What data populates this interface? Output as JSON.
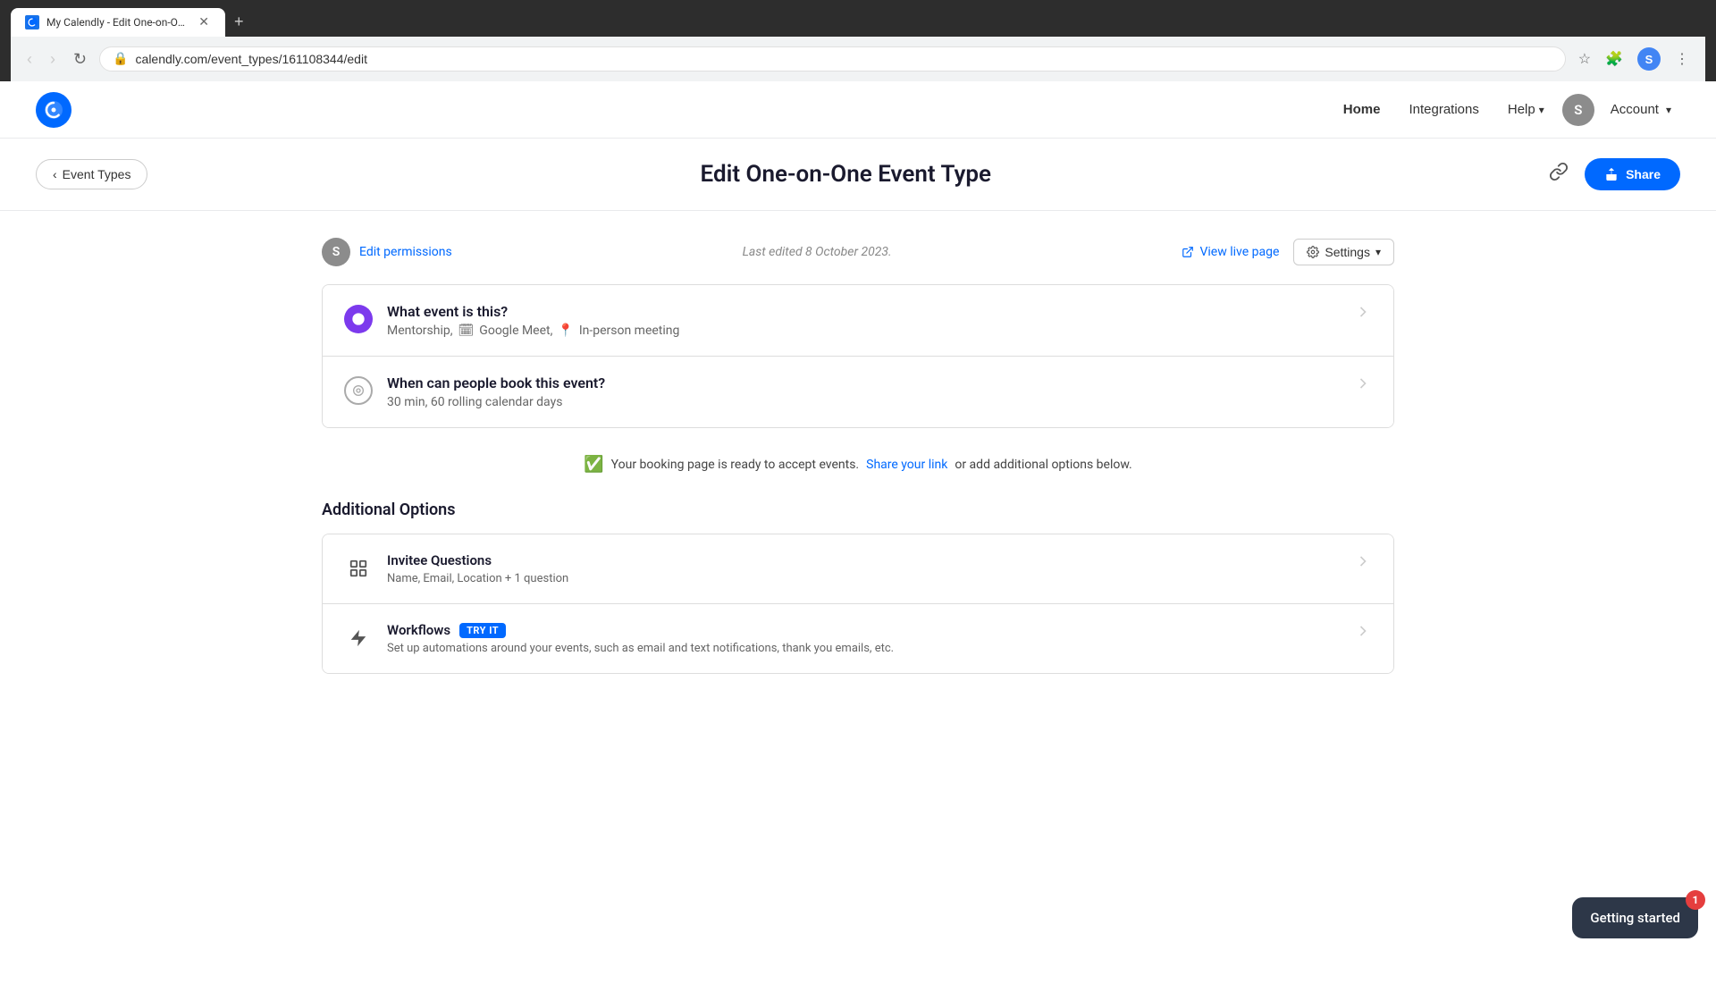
{
  "browser": {
    "tab": {
      "favicon": "C",
      "title": "My Calendly - Edit One-on-One..."
    },
    "url": "calendly.com/event_types/161108344/edit",
    "nav_buttons": {
      "back_disabled": true,
      "forward_disabled": true
    }
  },
  "nav": {
    "logo_letter": "C",
    "links": {
      "home": "Home",
      "integrations": "Integrations",
      "help": "Help",
      "account": "Account"
    },
    "avatar_letter": "S"
  },
  "header": {
    "back_button": "Event Types",
    "page_title": "Edit One-on-One Event Type",
    "share_button": "Share"
  },
  "permissions": {
    "avatar_letter": "S",
    "edit_link": "Edit permissions",
    "last_edited": "Last edited 8 October 2023.",
    "view_live": "View live page",
    "settings": "Settings"
  },
  "event_cards": [
    {
      "icon_type": "purple",
      "title": "What event is this?",
      "subtitle": "Mentorship, 🗓 Google Meet, 📍 In-person meeting",
      "subtitle_plain": "Mentorship,",
      "google_meet": "Google Meet,",
      "inperson": "In-person meeting"
    },
    {
      "icon_type": "outline",
      "title": "When can people book this event?",
      "subtitle": "30 min, 60 rolling calendar days"
    }
  ],
  "status": {
    "message": "Your booking page is ready to accept events.",
    "link_text": "Share your link",
    "suffix": "or add additional options below."
  },
  "additional_options": {
    "section_title": "Additional Options",
    "cards": [
      {
        "icon": "grid",
        "title": "Invitee Questions",
        "subtitle": "Name, Email, Location + 1 question",
        "badge": null
      },
      {
        "icon": "lightning",
        "title": "Workflows",
        "subtitle": "Set up automations around your events, such as email and text notifications, thank you emails, etc.",
        "badge": "TRY IT"
      }
    ]
  },
  "getting_started": {
    "label": "Getting started",
    "badge_count": "1"
  }
}
